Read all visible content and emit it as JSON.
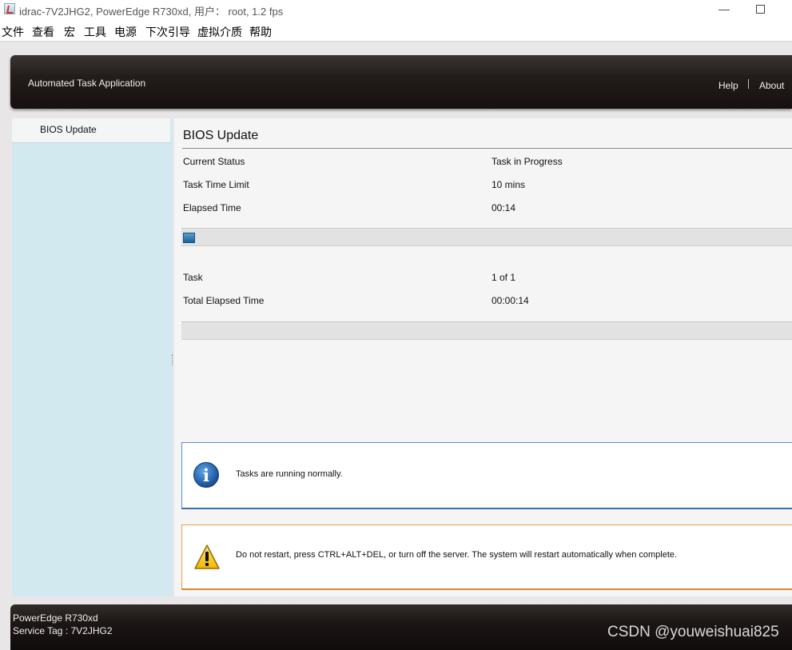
{
  "window": {
    "title": "idrac-7V2JHG2, PowerEdge R730xd, 用户： root, 1.2 fps",
    "minimize": "—"
  },
  "menu": [
    "文件",
    "查看",
    "宏",
    "工具",
    "电源",
    "下次引导",
    "虚拟介质",
    "帮助"
  ],
  "header": {
    "app_title": "Automated Task Application",
    "help": "Help",
    "about": "About"
  },
  "sidebar": {
    "items": [
      {
        "label": "BIOS Update",
        "selected": true
      }
    ]
  },
  "main": {
    "title": "BIOS Update",
    "current_status_label": "Current Status",
    "current_status_value": "Task in Progress",
    "time_limit_label": "Task Time Limit",
    "time_limit_value": "10 mins",
    "elapsed_label": "Elapsed Time",
    "elapsed_value": "00:14",
    "task_progress_fraction": 0.02,
    "task_label": "Task",
    "task_value": "1 of 1",
    "total_elapsed_label": "Total Elapsed Time",
    "total_elapsed_value": "00:00:14",
    "total_progress_fraction": 0.0
  },
  "messages": {
    "info_icon": "info-icon",
    "info": "Tasks are running normally.",
    "warning_icon": "warning-icon",
    "warning": "Do not restart, press CTRL+ALT+DEL, or turn off the server.  The system will restart automatically when complete."
  },
  "footer": {
    "model": "PowerEdge R730xd",
    "service_tag": "Service Tag : 7V2JHG2"
  },
  "watermark": "CSDN @youweishuai825",
  "colors": {
    "header_bg": "#1c1615",
    "sidebar_bg": "#d3e9f0",
    "info_border": "#3c6fa8",
    "warning_border": "#d08a2c",
    "progress_fill": "#1b5f95"
  }
}
